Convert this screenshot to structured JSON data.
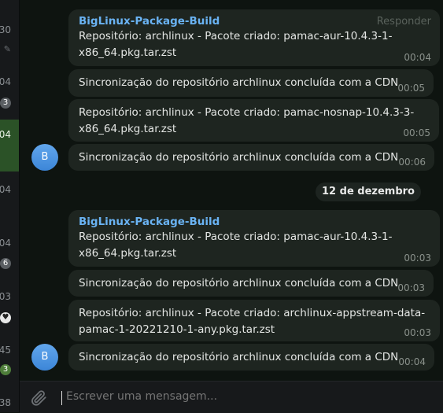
{
  "chat_list": {
    "times": [
      "30",
      "04",
      "04",
      "04",
      "04",
      "03",
      "45",
      "38"
    ],
    "badges": [
      "3",
      "6",
      "3"
    ],
    "heart": "♥"
  },
  "messages": [
    {
      "sender": "BigLinux-Package-Build",
      "reply": "Responder",
      "text": "Repositório: archlinux - Pacote criado: pamac-aur-10.4.3-1-\nx86_64.pkg.tar.zst",
      "time": "00:04"
    },
    {
      "text": "Sincronização do repositório archlinux concluída com a CDN",
      "time": "00:05"
    },
    {
      "text": "Repositório: archlinux - Pacote criado: pamac-nosnap-10.4.3-3-\nx86_64.pkg.tar.zst",
      "time": "00:05"
    },
    {
      "text": "Sincronização do repositório archlinux concluída com a CDN",
      "time": "00:06",
      "avatar": "B"
    },
    {
      "date": "12 de dezembro"
    },
    {
      "sender": "BigLinux-Package-Build",
      "text": "Repositório: archlinux - Pacote criado: pamac-aur-10.4.3-1-\nx86_64.pkg.tar.zst",
      "time": "00:03"
    },
    {
      "text": "Sincronização do repositório archlinux concluída com a CDN",
      "time": "00:03"
    },
    {
      "text": "Repositório: archlinux - Pacote criado: archlinux-appstream-data-\npamac-1-20221210-1-any.pkg.tar.zst",
      "time": "00:03"
    },
    {
      "text": "Sincronização do repositório archlinux concluída com a CDN",
      "time": "00:04",
      "avatar": "B"
    }
  ],
  "composer": {
    "placeholder": "Escrever uma mensagem..."
  },
  "icons": {
    "attach": "paperclip-icon",
    "pin": "pin-icon"
  },
  "colors": {
    "accent": "#6ab3f3",
    "bubble": "#1e2520",
    "selected": "#2b5227"
  }
}
